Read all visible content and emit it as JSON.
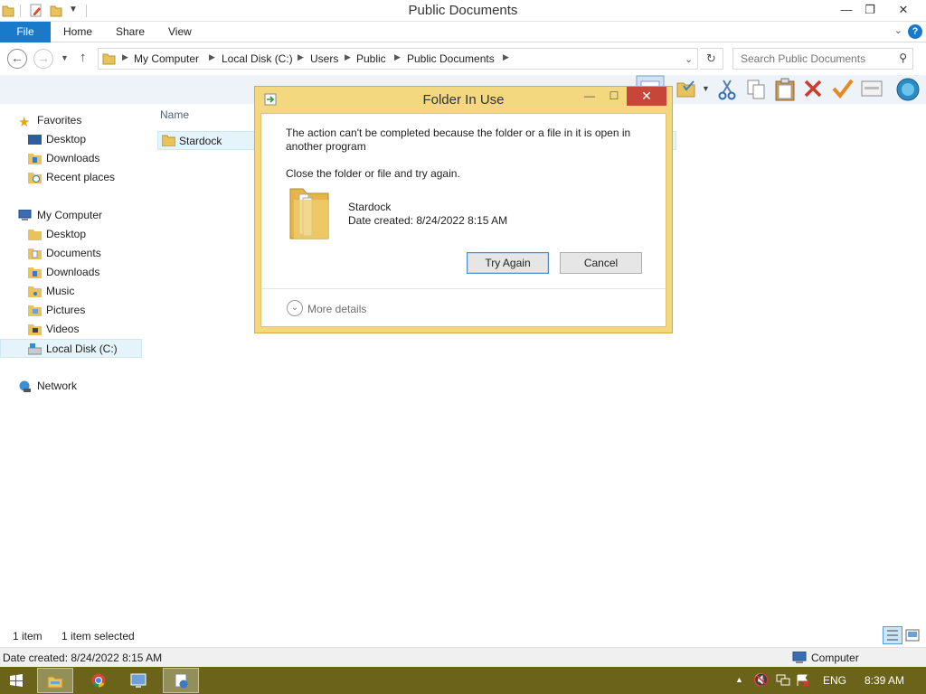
{
  "window": {
    "title": "Public Documents",
    "minimize": "—",
    "restore": "❐",
    "close": "✕"
  },
  "ribbon": {
    "file": "File",
    "tabs": [
      "Home",
      "Share",
      "View"
    ],
    "help": "?"
  },
  "address": {
    "crumbs": [
      "My Computer",
      "Local Disk (C:)",
      "Users",
      "Public",
      "Public Documents"
    ]
  },
  "search": {
    "placeholder": "Search Public Documents"
  },
  "sidebar": {
    "favorites": "Favorites",
    "favorites_items": [
      "Desktop",
      "Downloads",
      "Recent places"
    ],
    "computer": "My Computer",
    "computer_items": [
      "Desktop",
      "Documents",
      "Downloads",
      "Music",
      "Pictures",
      "Videos",
      "Local Disk (C:)"
    ],
    "network": "Network"
  },
  "filelist": {
    "column_name": "Name",
    "items": [
      "Stardock"
    ]
  },
  "dialog": {
    "title": "Folder In Use",
    "message": "The action can't be completed because the folder or a file in it is open in another program",
    "instruction": "Close the folder or file and try again.",
    "item_name": "Stardock",
    "item_date": "Date created: 8/24/2022 8:15 AM",
    "try_again": "Try Again",
    "cancel": "Cancel",
    "more_details": "More details"
  },
  "status": {
    "item_count": "1 item",
    "selected": "1 item selected",
    "details": "Date created: 8/24/2022 8:15 AM",
    "location": "Computer"
  },
  "taskbar": {
    "language": "ENG",
    "time": "8:39 AM"
  },
  "colors": {
    "accent": "#1979ca",
    "dialog_frame": "#f3d880",
    "close_button": "#c7463a",
    "taskbar": "#6b6319"
  }
}
